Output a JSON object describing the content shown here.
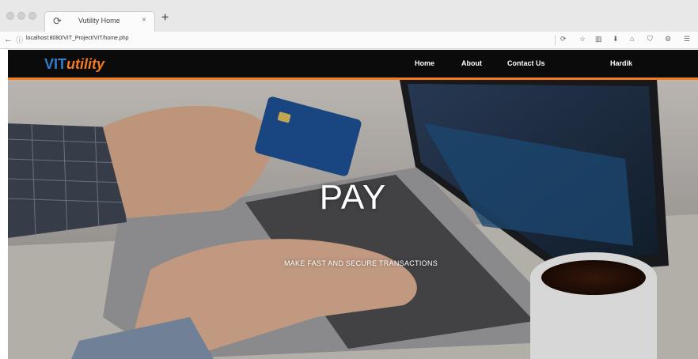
{
  "browser": {
    "tab_title": "Vutility Home",
    "tab_close": "×",
    "new_tab": "+",
    "url": "localhost:8080/VIT_Project/VIT/home.php"
  },
  "site": {
    "logo_part1": "VIT",
    "logo_part2": "utility",
    "nav": {
      "home": "Home",
      "about": "About",
      "contact": "Contact Us",
      "user": "Hardik"
    },
    "hero": {
      "title": "PAY",
      "subtitle": "MAKE FAST AND SECURE TRANSACTIONS"
    }
  },
  "colors": {
    "nav_bg": "#0b0b0b",
    "accent_orange": "#f47b20",
    "logo_blue": "#2f7fd1"
  },
  "icons": [
    "reload-icon",
    "back-icon",
    "info-icon",
    "star-icon",
    "library-icon",
    "download-icon",
    "home-icon",
    "shield-icon",
    "settings-icon",
    "menu-icon"
  ]
}
